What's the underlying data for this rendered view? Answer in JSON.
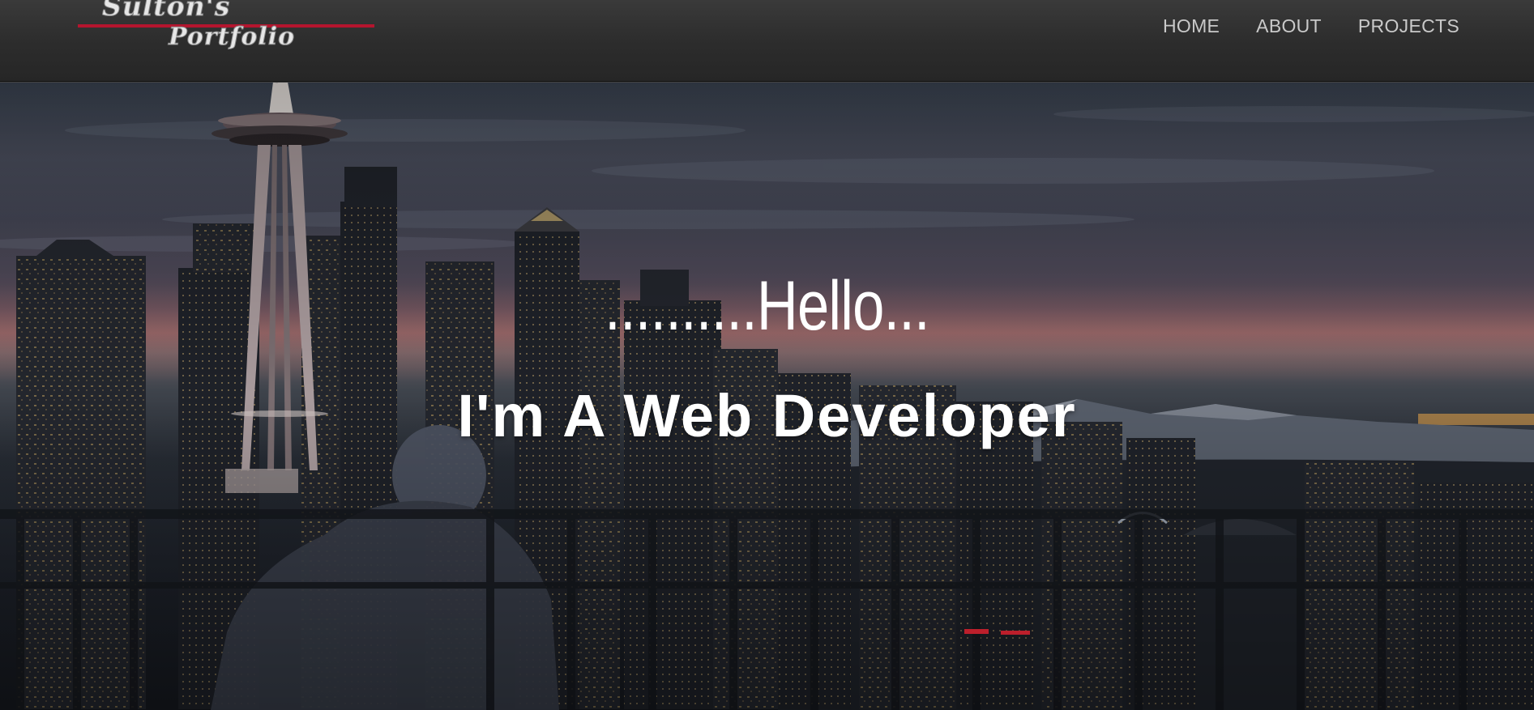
{
  "logo": {
    "line1": "Sulton's",
    "line2": "Portfolio",
    "accent_color": "#b4152e"
  },
  "nav": {
    "items": [
      {
        "label": "HOME"
      },
      {
        "label": "ABOUT"
      },
      {
        "label": "PROJECTS"
      }
    ]
  },
  "hero": {
    "greeting": "..........Hello...",
    "title": "I'm A Web Developer"
  }
}
